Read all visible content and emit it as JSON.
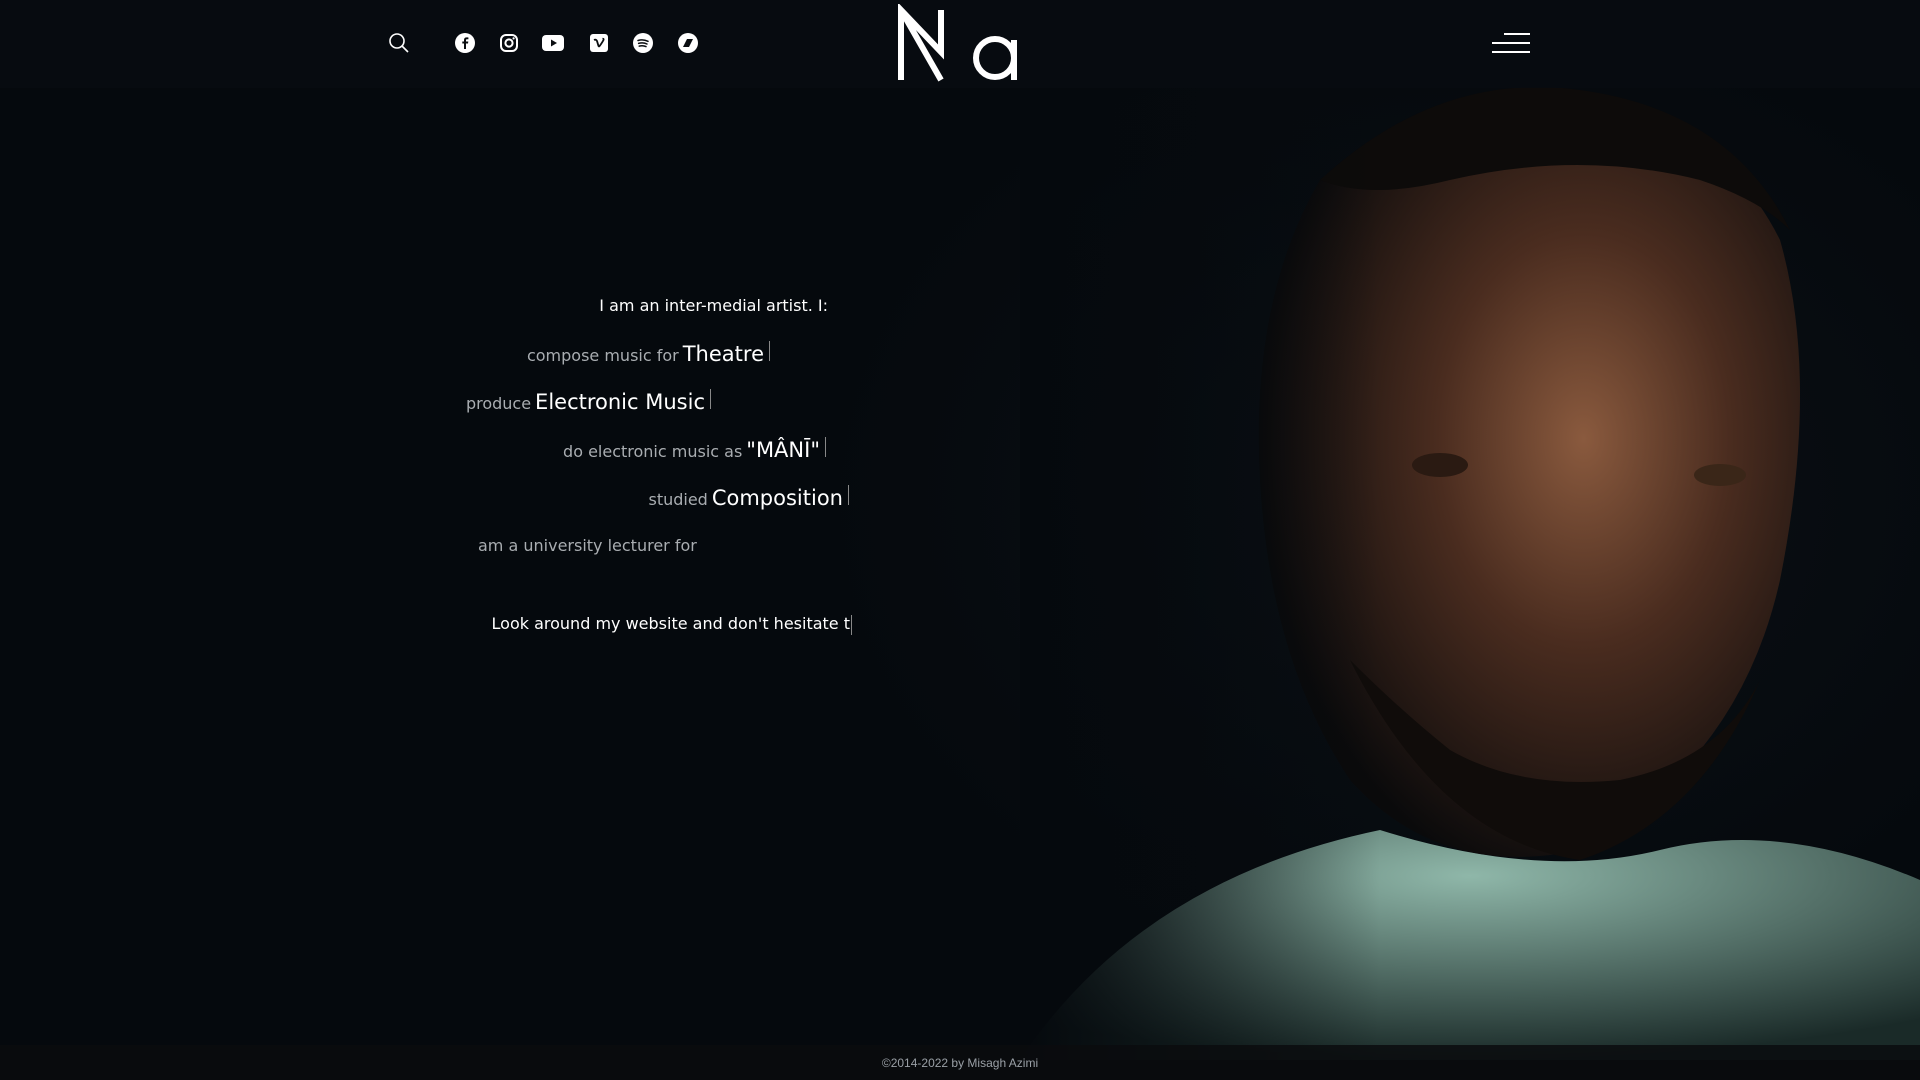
{
  "header": {
    "search_icon": "search-icon",
    "social_icons": [
      "facebook-icon",
      "instagram-icon",
      "youtube-icon",
      "vimeo-icon",
      "spotify-icon",
      "bandcamp-icon"
    ],
    "logo_text": "Ma",
    "menu_icon": "hamburger-menu-icon"
  },
  "intro": {
    "text": "I am an inter-medial artist. I:",
    "rows": [
      {
        "prefix": "compose music for",
        "highlight": "Theatre"
      },
      {
        "prefix": "produce",
        "highlight": "Electronic Music"
      },
      {
        "prefix": "do electronic music as",
        "highlight": "\"MÂNĪ\""
      },
      {
        "prefix": "studied",
        "highlight": "Composition"
      },
      {
        "prefix": "am a university lecturer for",
        "highlight": ""
      }
    ],
    "outro": "Look around my website and don't hesitate t"
  },
  "footer": {
    "copyright": "©2014-2022 by Misagh Azimi"
  },
  "colors": {
    "background": "#05090d",
    "header": "#080c10",
    "text": "#ffffff",
    "muted": "#a9adb1"
  }
}
